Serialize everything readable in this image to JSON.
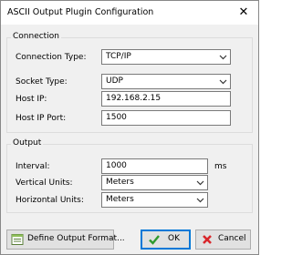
{
  "window": {
    "title": "ASCII Output Plugin Configuration",
    "close_glyph": "✕"
  },
  "connection": {
    "group_label": "Connection",
    "connection_type": {
      "label": "Connection Type:",
      "value": "TCP/IP"
    },
    "socket_type": {
      "label": "Socket Type:",
      "value": "UDP"
    },
    "host_ip": {
      "label": "Host IP:",
      "value": "192.168.2.15"
    },
    "host_port": {
      "label": "Host IP Port:",
      "value": "1500"
    }
  },
  "output": {
    "group_label": "Output",
    "interval": {
      "label": "Interval:",
      "value": "1000",
      "unit": "ms"
    },
    "vertical_units": {
      "label": "Vertical Units:",
      "value": "Meters"
    },
    "horizontal_units": {
      "label": "Horizontal Units:",
      "value": "Meters"
    }
  },
  "buttons": {
    "define": "Define Output Format...",
    "ok": "OK",
    "cancel": "Cancel"
  },
  "colors": {
    "ok_check": "#2e9a2e",
    "cancel_x": "#d9262b",
    "focus_border": "#0078d7"
  }
}
